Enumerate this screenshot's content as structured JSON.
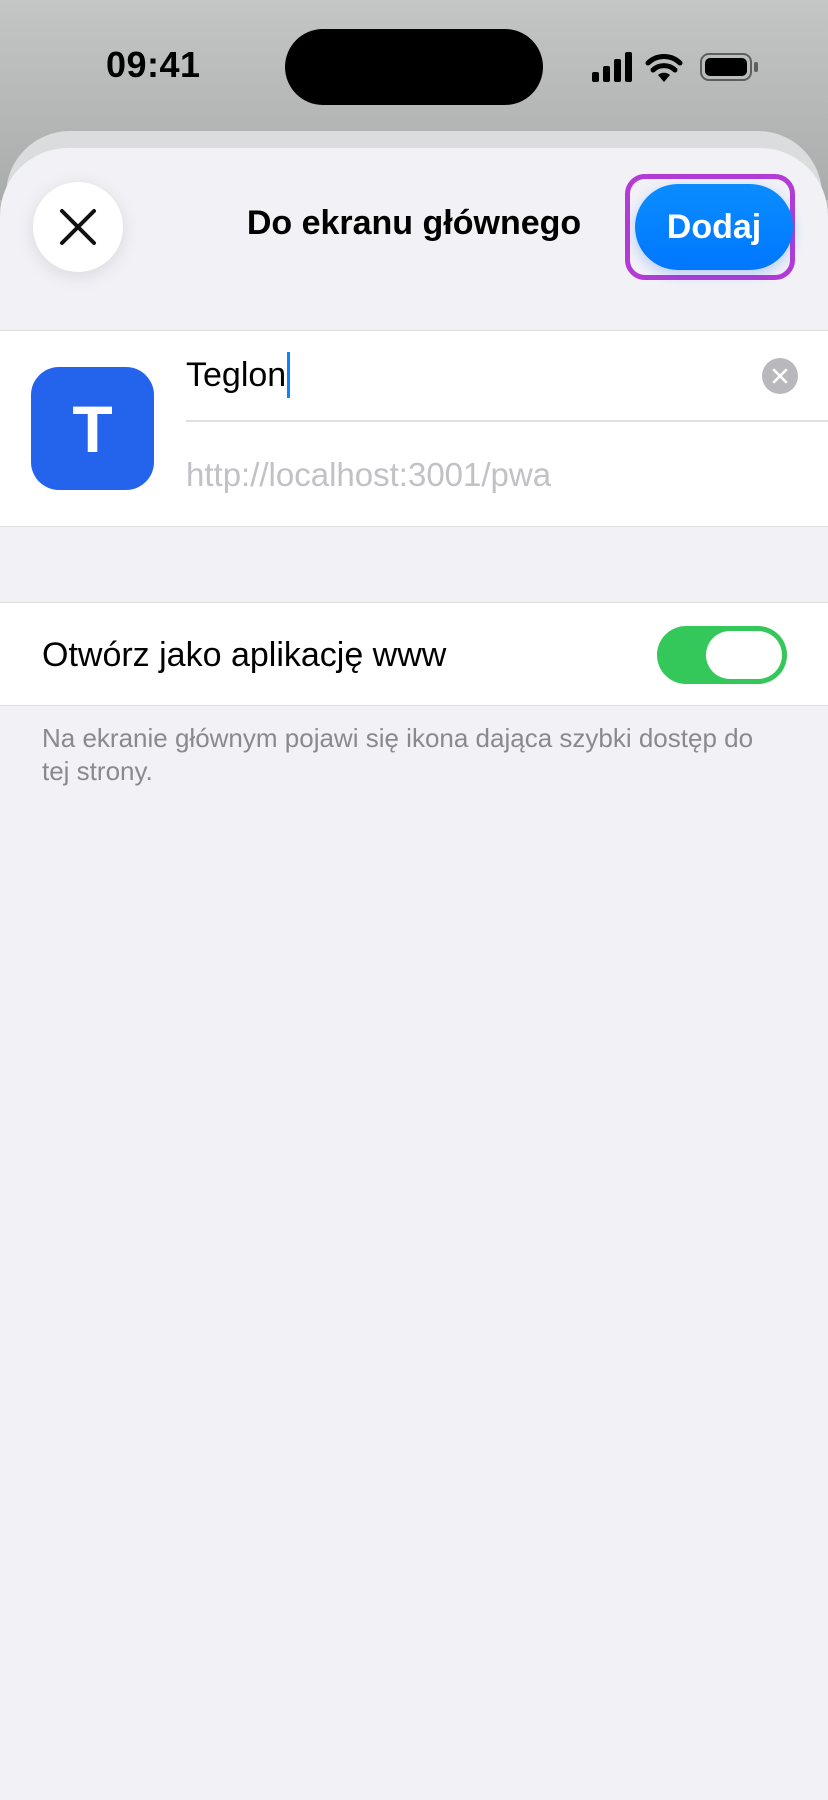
{
  "status_bar": {
    "time": "09:41"
  },
  "header": {
    "title": "Do ekranu głównego",
    "add_label": "Dodaj"
  },
  "app": {
    "icon_letter": "T",
    "name_value": "Teglon",
    "url": "http://localhost:3001/pwa"
  },
  "options": {
    "web_app_label": "Otwórz jako aplikację www",
    "web_app_enabled": true
  },
  "footnote": "Na ekranie głównym pojawi się ikona dająca szybki dostęp do tej strony.",
  "colors": {
    "accent": "#0a84ff",
    "toggle_on": "#34c759",
    "app_icon": "#2463eb",
    "highlight": "#b33bd6"
  },
  "icons": {
    "close": "close-icon",
    "clear": "clear-text-icon",
    "signal": "cellular-signal-icon",
    "wifi": "wifi-icon",
    "battery": "battery-icon"
  }
}
